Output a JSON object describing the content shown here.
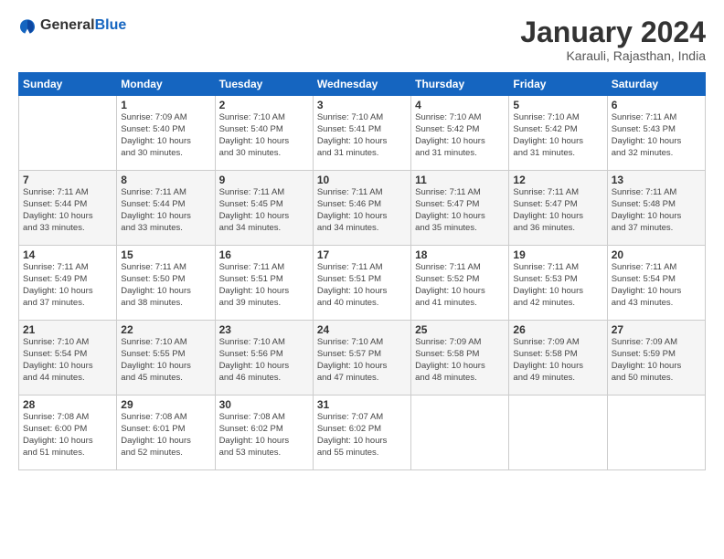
{
  "header": {
    "logo_general": "General",
    "logo_blue": "Blue",
    "title": "January 2024",
    "location": "Karauli, Rajasthan, India"
  },
  "weekdays": [
    "Sunday",
    "Monday",
    "Tuesday",
    "Wednesday",
    "Thursday",
    "Friday",
    "Saturday"
  ],
  "weeks": [
    [
      {
        "day": "",
        "info": ""
      },
      {
        "day": "1",
        "info": "Sunrise: 7:09 AM\nSunset: 5:40 PM\nDaylight: 10 hours\nand 30 minutes."
      },
      {
        "day": "2",
        "info": "Sunrise: 7:10 AM\nSunset: 5:40 PM\nDaylight: 10 hours\nand 30 minutes."
      },
      {
        "day": "3",
        "info": "Sunrise: 7:10 AM\nSunset: 5:41 PM\nDaylight: 10 hours\nand 31 minutes."
      },
      {
        "day": "4",
        "info": "Sunrise: 7:10 AM\nSunset: 5:42 PM\nDaylight: 10 hours\nand 31 minutes."
      },
      {
        "day": "5",
        "info": "Sunrise: 7:10 AM\nSunset: 5:42 PM\nDaylight: 10 hours\nand 31 minutes."
      },
      {
        "day": "6",
        "info": "Sunrise: 7:11 AM\nSunset: 5:43 PM\nDaylight: 10 hours\nand 32 minutes."
      }
    ],
    [
      {
        "day": "7",
        "info": "Sunrise: 7:11 AM\nSunset: 5:44 PM\nDaylight: 10 hours\nand 33 minutes."
      },
      {
        "day": "8",
        "info": "Sunrise: 7:11 AM\nSunset: 5:44 PM\nDaylight: 10 hours\nand 33 minutes."
      },
      {
        "day": "9",
        "info": "Sunrise: 7:11 AM\nSunset: 5:45 PM\nDaylight: 10 hours\nand 34 minutes."
      },
      {
        "day": "10",
        "info": "Sunrise: 7:11 AM\nSunset: 5:46 PM\nDaylight: 10 hours\nand 34 minutes."
      },
      {
        "day": "11",
        "info": "Sunrise: 7:11 AM\nSunset: 5:47 PM\nDaylight: 10 hours\nand 35 minutes."
      },
      {
        "day": "12",
        "info": "Sunrise: 7:11 AM\nSunset: 5:47 PM\nDaylight: 10 hours\nand 36 minutes."
      },
      {
        "day": "13",
        "info": "Sunrise: 7:11 AM\nSunset: 5:48 PM\nDaylight: 10 hours\nand 37 minutes."
      }
    ],
    [
      {
        "day": "14",
        "info": "Sunrise: 7:11 AM\nSunset: 5:49 PM\nDaylight: 10 hours\nand 37 minutes."
      },
      {
        "day": "15",
        "info": "Sunrise: 7:11 AM\nSunset: 5:50 PM\nDaylight: 10 hours\nand 38 minutes."
      },
      {
        "day": "16",
        "info": "Sunrise: 7:11 AM\nSunset: 5:51 PM\nDaylight: 10 hours\nand 39 minutes."
      },
      {
        "day": "17",
        "info": "Sunrise: 7:11 AM\nSunset: 5:51 PM\nDaylight: 10 hours\nand 40 minutes."
      },
      {
        "day": "18",
        "info": "Sunrise: 7:11 AM\nSunset: 5:52 PM\nDaylight: 10 hours\nand 41 minutes."
      },
      {
        "day": "19",
        "info": "Sunrise: 7:11 AM\nSunset: 5:53 PM\nDaylight: 10 hours\nand 42 minutes."
      },
      {
        "day": "20",
        "info": "Sunrise: 7:11 AM\nSunset: 5:54 PM\nDaylight: 10 hours\nand 43 minutes."
      }
    ],
    [
      {
        "day": "21",
        "info": "Sunrise: 7:10 AM\nSunset: 5:54 PM\nDaylight: 10 hours\nand 44 minutes."
      },
      {
        "day": "22",
        "info": "Sunrise: 7:10 AM\nSunset: 5:55 PM\nDaylight: 10 hours\nand 45 minutes."
      },
      {
        "day": "23",
        "info": "Sunrise: 7:10 AM\nSunset: 5:56 PM\nDaylight: 10 hours\nand 46 minutes."
      },
      {
        "day": "24",
        "info": "Sunrise: 7:10 AM\nSunset: 5:57 PM\nDaylight: 10 hours\nand 47 minutes."
      },
      {
        "day": "25",
        "info": "Sunrise: 7:09 AM\nSunset: 5:58 PM\nDaylight: 10 hours\nand 48 minutes."
      },
      {
        "day": "26",
        "info": "Sunrise: 7:09 AM\nSunset: 5:58 PM\nDaylight: 10 hours\nand 49 minutes."
      },
      {
        "day": "27",
        "info": "Sunrise: 7:09 AM\nSunset: 5:59 PM\nDaylight: 10 hours\nand 50 minutes."
      }
    ],
    [
      {
        "day": "28",
        "info": "Sunrise: 7:08 AM\nSunset: 6:00 PM\nDaylight: 10 hours\nand 51 minutes."
      },
      {
        "day": "29",
        "info": "Sunrise: 7:08 AM\nSunset: 6:01 PM\nDaylight: 10 hours\nand 52 minutes."
      },
      {
        "day": "30",
        "info": "Sunrise: 7:08 AM\nSunset: 6:02 PM\nDaylight: 10 hours\nand 53 minutes."
      },
      {
        "day": "31",
        "info": "Sunrise: 7:07 AM\nSunset: 6:02 PM\nDaylight: 10 hours\nand 55 minutes."
      },
      {
        "day": "",
        "info": ""
      },
      {
        "day": "",
        "info": ""
      },
      {
        "day": "",
        "info": ""
      }
    ]
  ]
}
